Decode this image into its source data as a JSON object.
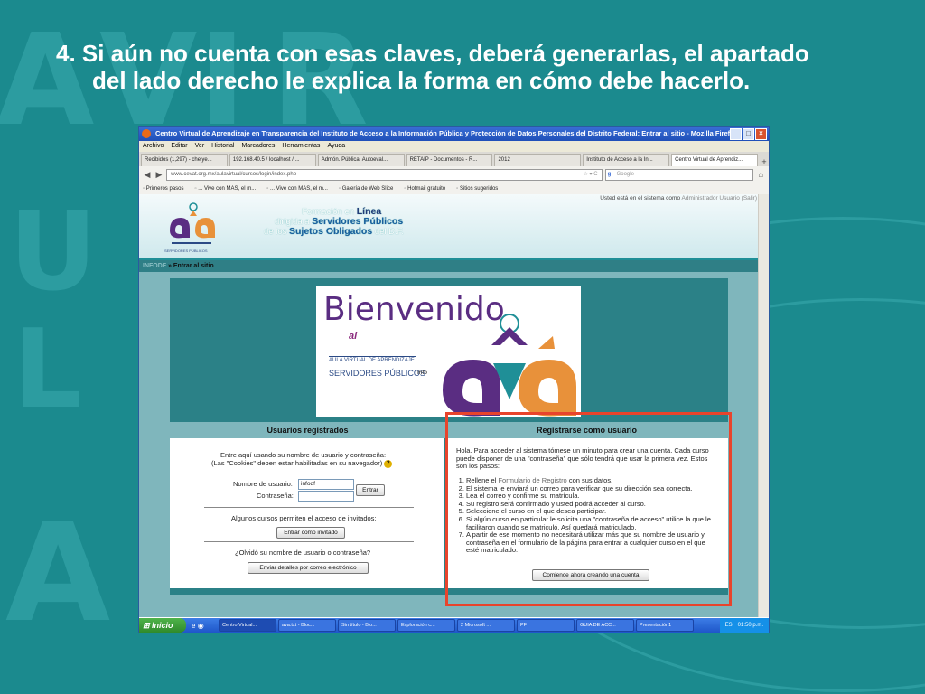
{
  "slide": {
    "title_line1": "4. Si aún no cuenta con esas claves, deberá generarlas, el apartado",
    "title_line2": "del lado derecho le explica la forma en cómo debe hacerlo.",
    "bg_letters": [
      "A",
      "V",
      "I",
      "R",
      "A",
      "U",
      "L",
      "A",
      "A"
    ]
  },
  "browser": {
    "title": "Centro Virtual de Aprendizaje en Transparencia del Instituto de Acceso a la Información Pública y Protección de Datos Personales del Distrito Federal: Entrar al sitio - Mozilla Firefox",
    "menu": [
      "Archivo",
      "Editar",
      "Ver",
      "Historial",
      "Marcadores",
      "Herramientas",
      "Ayuda"
    ],
    "tabs": [
      "Recibidos (1,297) - chelye...",
      "192.168.40.5 / localhost / ...",
      "Admón. Pública: Autoeval...",
      "RETAIP - Documentos - R...",
      "2012",
      "Instituto de Acceso a la In...",
      "Centro Virtual de Aprendiz..."
    ],
    "url": "www.cevat.org.mx/aulavirtual/cursos/login/index.php",
    "search_placeholder": "Google",
    "bookmarks": [
      "Primeros pasos",
      "... Vive con MAS, el m...",
      "... Vive con MAS, el m...",
      "Galería de Web Slice",
      "Hotmail gratuito",
      "Sitios sugeridos"
    ]
  },
  "page": {
    "session_text": "Usted está en el sistema como",
    "session_user": "Administrador Usuario",
    "session_logout": "(Salir)",
    "slogan_l1a": "Formación en ",
    "slogan_l1b": "Línea",
    "slogan_l2a": "dirigida a ",
    "slogan_l2b": "Servidores Públicos",
    "slogan_l3a": "de los ",
    "slogan_l3b": "Sujetos Obligados",
    "slogan_l3c": " del D.F.",
    "logo_caption": "SERVIDORES PÚBLICOS",
    "crumb_site": "INFODF",
    "crumb_sep": " » ",
    "crumb_page": "Entrar al sitio",
    "welcome": {
      "title": "Bienvenido",
      "al": "al",
      "aula": "AULA VIRTUAL DE APRENDIZAJE",
      "servidores": "SERVIDORES PÚBLICOS",
      "info": "info"
    },
    "left": {
      "header": "Usuarios registrados",
      "intro_l1": "Entre aquí usando su nombre de usuario y contraseña:",
      "intro_l2": "(Las \"Cookies\" deben estar habilitadas en su navegador)",
      "help": "?",
      "username_label": "Nombre de usuario:",
      "username_value": "infodf",
      "password_label": "Contraseña:",
      "login_button": "Entrar",
      "guest_text": "Algunos cursos permiten el acceso de invitados:",
      "guest_button": "Entrar como invitado",
      "forgot_text": "¿Olvidó su nombre de usuario o contraseña?",
      "forgot_button": "Enviar detalles por correo electrónico"
    },
    "right": {
      "header": "Registrarse como usuario",
      "intro": "Hola. Para acceder al sistema tómese un minuto para crear una cuenta. Cada curso puede disponer de una \"contraseña\" que sólo tendrá que usar la primera vez. Estos son los pasos:",
      "step1_pre": "Rellene el ",
      "step1_link": "Formulario de Registro",
      "step1_post": " con sus datos.",
      "steps": [
        "El sistema le enviará un correo para verificar que su dirección sea correcta.",
        "Lea el correo y confirme su matrícula.",
        "Su registro será confirmado y usted podrá acceder al curso.",
        "Seleccione el curso en el que desea participar.",
        "Si algún curso en particular le solicita una \"contraseña de acceso\" utilice la que le facilitaron cuando se matriculó. Así quedará matriculado.",
        "A partir de ese momento no necesitará utilizar más que su nombre de usuario y contraseña en el formulario de la página para entrar a cualquier curso en el que esté matriculado."
      ],
      "signup_button": "Comience ahora creando una cuenta"
    }
  },
  "taskbar": {
    "start": "Inicio",
    "items": [
      "Centro Virtual...",
      "ava.txt - Bloc...",
      "Sin título - Blo...",
      "Exploración c...",
      "2 Microsoft ...",
      "PF",
      "GUIA DE ACC...",
      "Presentación1"
    ],
    "lang": "ES",
    "clock": "01:50 p.m."
  },
  "colors": {
    "slide_bg": "#1b8a8e",
    "highlight": "#e8442c",
    "site_teal": "#2b8187",
    "brand_purple": "#5a2d82",
    "brand_orange": "#e8913a"
  }
}
